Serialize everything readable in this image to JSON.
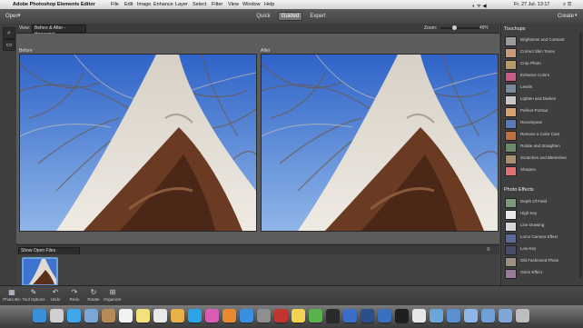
{
  "menubar": {
    "app_name": "Adobe Photoshop Elements Editor",
    "menus": [
      "File",
      "Edit",
      "Image",
      "Enhance",
      "Layer",
      "Select",
      "Filter",
      "View",
      "Window",
      "Help"
    ],
    "clock": "Fr. 27 Jul. 13:17"
  },
  "topbar": {
    "open_label": "Open",
    "modes": [
      "Quick",
      "Guided",
      "Expert"
    ],
    "active_mode": "Guided",
    "create_label": "Create"
  },
  "options": {
    "view_label": "View:",
    "view_value": "Before & After - Horizontal",
    "zoom_label": "Zoom:",
    "zoom_value": "49%",
    "zoom_fraction": 0.49
  },
  "canvas": {
    "before_label": "Before",
    "after_label": "After"
  },
  "bin": {
    "dropdown": "Show Open Files"
  },
  "panel": {
    "sections": [
      {
        "title": "Touchups",
        "items": [
          "Brightness and Contrast",
          "Correct Skin Tones",
          "Crop Photo",
          "Enhance Colors",
          "Levels",
          "Lighten and Darken",
          "Perfect Portrait",
          "Recompose",
          "Remove a Color Cast",
          "Rotate and Straighten",
          "Scratches and Blemishes",
          "Sharpen"
        ]
      },
      {
        "title": "Photo Effects",
        "items": [
          "Depth Of Field",
          "High Key",
          "Line Drawing",
          "Lomo Camera Effect",
          "Low Key",
          "Old Fashioned Photo",
          "Orton Effect"
        ]
      }
    ]
  },
  "bottombar": {
    "items": [
      {
        "label": "Photo Bin",
        "icon": "photo-bin-icon"
      },
      {
        "label": "Tool Options",
        "icon": "tool-options-icon"
      },
      {
        "label": "Undo",
        "icon": "undo-icon"
      },
      {
        "label": "Redo",
        "icon": "redo-icon"
      },
      {
        "label": "Rotate",
        "icon": "rotate-icon"
      },
      {
        "label": "Organizer",
        "icon": "organizer-icon"
      }
    ]
  },
  "dock": {
    "icons": [
      "finder-icon",
      "launchpad-icon",
      "safari-icon",
      "mail-icon",
      "contacts-icon",
      "calendar-icon",
      "notes-icon",
      "reminders-icon",
      "photos-icon",
      "skype-icon",
      "itunes-icon",
      "ibooks-icon",
      "appstore-icon",
      "preferences-icon",
      "filezilla-icon",
      "stickies-icon",
      "messages-icon",
      "spotify-icon",
      "editor-icon",
      "photoshop-elements-icon",
      "organizer-icon",
      "terminal-icon",
      "textedit-icon",
      "preview-icon",
      "xcode-icon",
      "trash-folder-icon",
      "downloads-icon",
      "documents-icon",
      "trash-icon"
    ],
    "colors": [
      "#3b8fd9",
      "#cfcfcf",
      "#3fa6e8",
      "#7aa7d8",
      "#b58a5a",
      "#f2f2f2",
      "#f3e27a",
      "#e9e9e9",
      "#e8b04a",
      "#2aa4e6",
      "#d85db3",
      "#e88a2f",
      "#3a8fe0",
      "#8f8f8f",
      "#c0352e",
      "#f2d24e",
      "#58b44a",
      "#2a2a2a",
      "#3a6ec8",
      "#2a4f8a",
      "#3b6fbf",
      "#1f1f1f",
      "#e8e8e8",
      "#6aa6d8",
      "#5b8fd0",
      "#8db5e8",
      "#6f9fd8",
      "#7ea7d8",
      "#bdbdbd"
    ]
  }
}
